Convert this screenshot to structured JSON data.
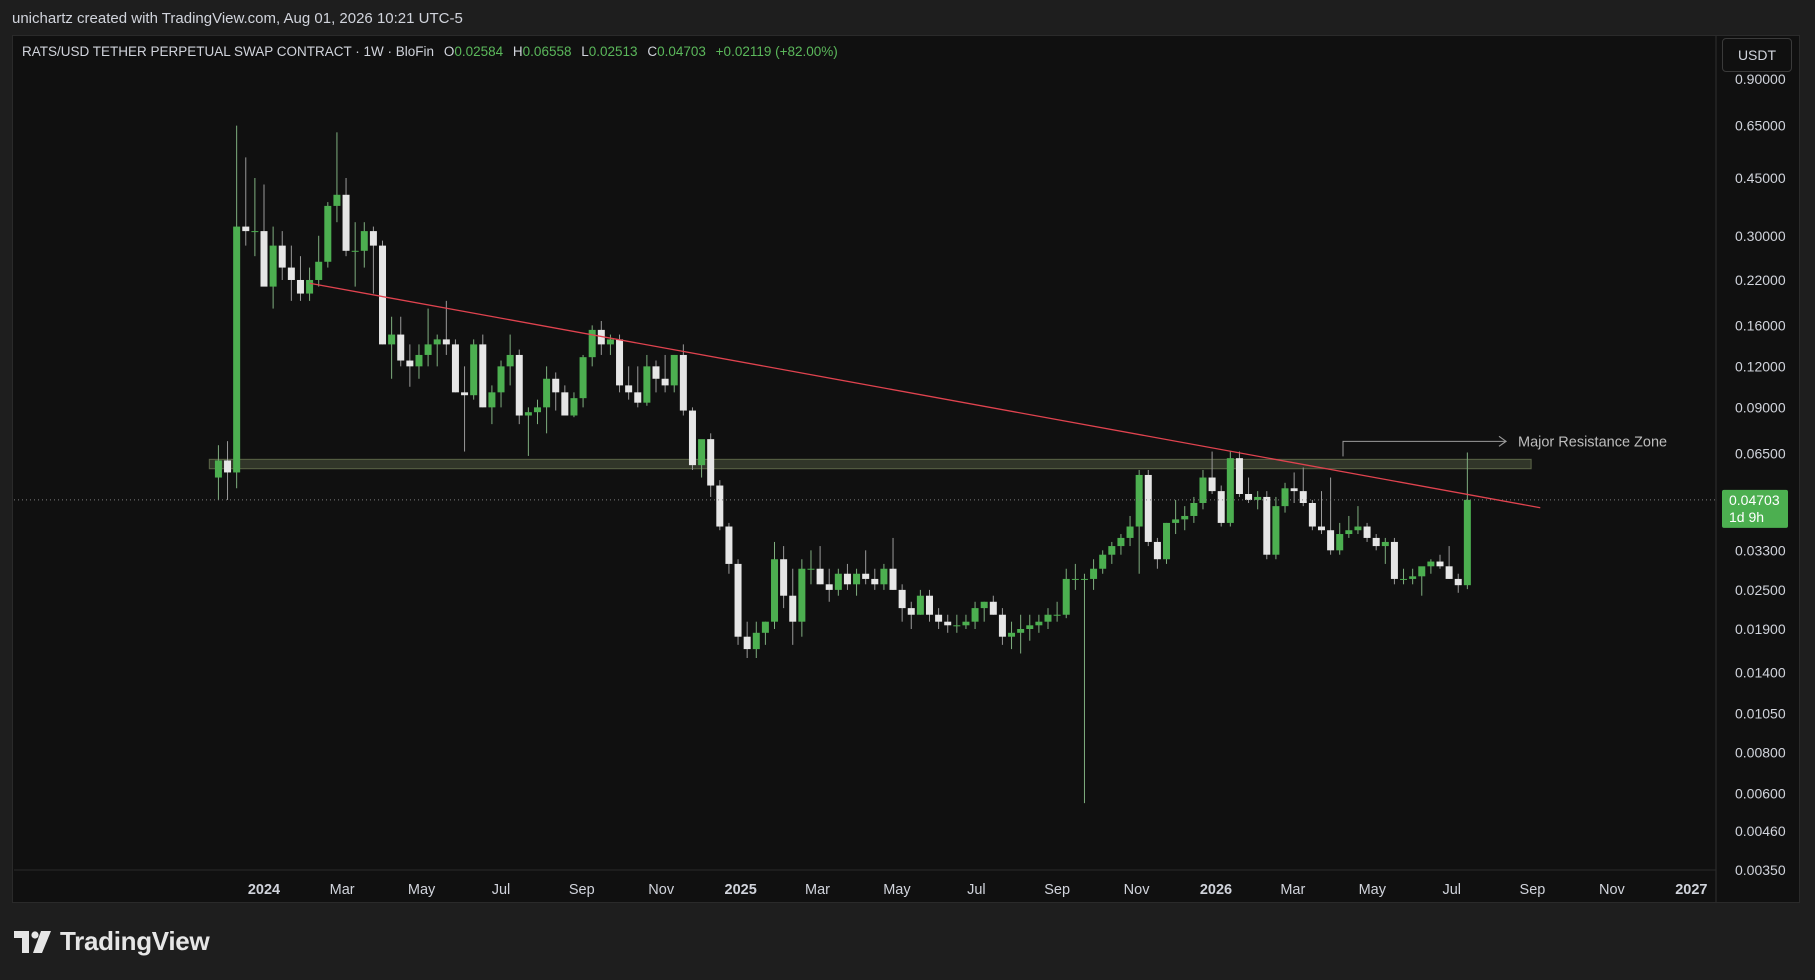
{
  "header": {
    "credit": "unichartz created with TradingView.com, Aug 01, 2026 10:21 UTC-5"
  },
  "legend": {
    "symbol": "RATS/USD TETHER PERPETUAL SWAP CONTRACT · 1W · BloFin",
    "o_label": "O",
    "o": "0.02584",
    "h_label": "H",
    "h": "0.06558",
    "l_label": "L",
    "l": "0.02513",
    "c_label": "C",
    "c": "0.04703",
    "change": "+0.02119 (+82.00%)"
  },
  "toolbar": {
    "currency_label": "USDT"
  },
  "price_label": {
    "price": "0.04703",
    "countdown": "1d 9h"
  },
  "annotation": {
    "resistance_label": "Major Resistance Zone"
  },
  "brand": {
    "name": "TradingView"
  },
  "colors": {
    "up": "#4caf50",
    "down": "#e6e6e6",
    "trendline": "#e0434f",
    "zone": "#8a9a6a",
    "price_tag": "#4caf50"
  },
  "chart_data": {
    "type": "candlestick",
    "timeframe": "1W",
    "y_scale": "log",
    "y_ticks": [
      "0.90000",
      "0.65000",
      "0.45000",
      "0.30000",
      "0.22000",
      "0.16000",
      "0.12000",
      "0.09000",
      "0.06500",
      "0.04703",
      "0.03300",
      "0.02500",
      "0.01900",
      "0.01400",
      "0.01050",
      "0.00800",
      "0.00600",
      "0.00460",
      "0.00350"
    ],
    "x_ticks": [
      {
        "label": "2024",
        "date": "2024-01-01",
        "bold": true
      },
      {
        "label": "Mar",
        "date": "2024-03-01"
      },
      {
        "label": "May",
        "date": "2024-05-01"
      },
      {
        "label": "Jul",
        "date": "2024-07-01"
      },
      {
        "label": "Sep",
        "date": "2024-09-01"
      },
      {
        "label": "Nov",
        "date": "2024-11-01"
      },
      {
        "label": "2025",
        "date": "2025-01-01",
        "bold": true
      },
      {
        "label": "Mar",
        "date": "2025-03-01"
      },
      {
        "label": "May",
        "date": "2025-05-01"
      },
      {
        "label": "Jul",
        "date": "2025-07-01"
      },
      {
        "label": "Sep",
        "date": "2025-09-01"
      },
      {
        "label": "Nov",
        "date": "2025-11-01"
      },
      {
        "label": "2026",
        "date": "2026-01-01",
        "bold": true
      },
      {
        "label": "Mar",
        "date": "2026-03-01"
      },
      {
        "label": "May",
        "date": "2026-05-01"
      },
      {
        "label": "Jul",
        "date": "2026-07-01"
      },
      {
        "label": "Sep",
        "date": "2026-09-01"
      },
      {
        "label": "Nov",
        "date": "2026-11-01"
      },
      {
        "label": "2027",
        "date": "2027-01-01",
        "bold": true
      }
    ],
    "candles": [
      {
        "d": "2023-11-27",
        "o": 0.055,
        "h": 0.069,
        "l": 0.047,
        "c": 0.062
      },
      {
        "d": "2023-12-04",
        "o": 0.062,
        "h": 0.071,
        "l": 0.047,
        "c": 0.057
      },
      {
        "d": "2023-12-11",
        "o": 0.057,
        "h": 0.65,
        "l": 0.051,
        "c": 0.32
      },
      {
        "d": "2023-12-18",
        "o": 0.32,
        "h": 0.52,
        "l": 0.28,
        "c": 0.31
      },
      {
        "d": "2023-12-25",
        "o": 0.31,
        "h": 0.45,
        "l": 0.26,
        "c": 0.31
      },
      {
        "d": "2024-01-01",
        "o": 0.31,
        "h": 0.43,
        "l": 0.24,
        "c": 0.21
      },
      {
        "d": "2024-01-08",
        "o": 0.21,
        "h": 0.32,
        "l": 0.18,
        "c": 0.28
      },
      {
        "d": "2024-01-15",
        "o": 0.28,
        "h": 0.31,
        "l": 0.22,
        "c": 0.24
      },
      {
        "d": "2024-01-22",
        "o": 0.24,
        "h": 0.28,
        "l": 0.19,
        "c": 0.22
      },
      {
        "d": "2024-01-29",
        "o": 0.22,
        "h": 0.26,
        "l": 0.19,
        "c": 0.2
      },
      {
        "d": "2024-02-05",
        "o": 0.2,
        "h": 0.24,
        "l": 0.19,
        "c": 0.22
      },
      {
        "d": "2024-02-12",
        "o": 0.22,
        "h": 0.3,
        "l": 0.21,
        "c": 0.25
      },
      {
        "d": "2024-02-19",
        "o": 0.25,
        "h": 0.38,
        "l": 0.24,
        "c": 0.37
      },
      {
        "d": "2024-02-26",
        "o": 0.37,
        "h": 0.62,
        "l": 0.33,
        "c": 0.4
      },
      {
        "d": "2024-03-04",
        "o": 0.4,
        "h": 0.45,
        "l": 0.26,
        "c": 0.27
      },
      {
        "d": "2024-03-11",
        "o": 0.27,
        "h": 0.33,
        "l": 0.21,
        "c": 0.27
      },
      {
        "d": "2024-03-18",
        "o": 0.27,
        "h": 0.33,
        "l": 0.24,
        "c": 0.31
      },
      {
        "d": "2024-03-25",
        "o": 0.31,
        "h": 0.32,
        "l": 0.2,
        "c": 0.28
      },
      {
        "d": "2024-04-01",
        "o": 0.28,
        "h": 0.29,
        "l": 0.14,
        "c": 0.14
      },
      {
        "d": "2024-04-08",
        "o": 0.14,
        "h": 0.17,
        "l": 0.11,
        "c": 0.15
      },
      {
        "d": "2024-04-15",
        "o": 0.15,
        "h": 0.17,
        "l": 0.12,
        "c": 0.125
      },
      {
        "d": "2024-04-22",
        "o": 0.125,
        "h": 0.14,
        "l": 0.104,
        "c": 0.12
      },
      {
        "d": "2024-04-29",
        "o": 0.12,
        "h": 0.14,
        "l": 0.11,
        "c": 0.13
      },
      {
        "d": "2024-05-06",
        "o": 0.13,
        "h": 0.18,
        "l": 0.12,
        "c": 0.14
      },
      {
        "d": "2024-05-13",
        "o": 0.14,
        "h": 0.15,
        "l": 0.12,
        "c": 0.145
      },
      {
        "d": "2024-05-20",
        "o": 0.145,
        "h": 0.19,
        "l": 0.13,
        "c": 0.14
      },
      {
        "d": "2024-05-27",
        "o": 0.14,
        "h": 0.145,
        "l": 0.1,
        "c": 0.1
      },
      {
        "d": "2024-06-03",
        "o": 0.1,
        "h": 0.12,
        "l": 0.066,
        "c": 0.098
      },
      {
        "d": "2024-06-10",
        "o": 0.098,
        "h": 0.145,
        "l": 0.095,
        "c": 0.14
      },
      {
        "d": "2024-06-17",
        "o": 0.14,
        "h": 0.15,
        "l": 0.09,
        "c": 0.09
      },
      {
        "d": "2024-06-24",
        "o": 0.09,
        "h": 0.105,
        "l": 0.08,
        "c": 0.1
      },
      {
        "d": "2024-07-01",
        "o": 0.1,
        "h": 0.125,
        "l": 0.09,
        "c": 0.12
      },
      {
        "d": "2024-07-08",
        "o": 0.12,
        "h": 0.15,
        "l": 0.105,
        "c": 0.13
      },
      {
        "d": "2024-07-15",
        "o": 0.13,
        "h": 0.135,
        "l": 0.08,
        "c": 0.085
      },
      {
        "d": "2024-07-22",
        "o": 0.085,
        "h": 0.09,
        "l": 0.064,
        "c": 0.087
      },
      {
        "d": "2024-07-29",
        "o": 0.087,
        "h": 0.095,
        "l": 0.08,
        "c": 0.09
      },
      {
        "d": "2024-08-05",
        "o": 0.09,
        "h": 0.12,
        "l": 0.075,
        "c": 0.11
      },
      {
        "d": "2024-08-12",
        "o": 0.11,
        "h": 0.115,
        "l": 0.088,
        "c": 0.1
      },
      {
        "d": "2024-08-19",
        "o": 0.1,
        "h": 0.105,
        "l": 0.085,
        "c": 0.085
      },
      {
        "d": "2024-08-26",
        "o": 0.085,
        "h": 0.1,
        "l": 0.084,
        "c": 0.096
      },
      {
        "d": "2024-09-02",
        "o": 0.096,
        "h": 0.13,
        "l": 0.09,
        "c": 0.128
      },
      {
        "d": "2024-09-09",
        "o": 0.128,
        "h": 0.16,
        "l": 0.12,
        "c": 0.155
      },
      {
        "d": "2024-09-16",
        "o": 0.155,
        "h": 0.165,
        "l": 0.13,
        "c": 0.14
      },
      {
        "d": "2024-09-23",
        "o": 0.14,
        "h": 0.15,
        "l": 0.13,
        "c": 0.145
      },
      {
        "d": "2024-09-30",
        "o": 0.145,
        "h": 0.15,
        "l": 0.1,
        "c": 0.105
      },
      {
        "d": "2024-10-07",
        "o": 0.105,
        "h": 0.12,
        "l": 0.095,
        "c": 0.1
      },
      {
        "d": "2024-10-14",
        "o": 0.1,
        "h": 0.12,
        "l": 0.09,
        "c": 0.093
      },
      {
        "d": "2024-10-21",
        "o": 0.093,
        "h": 0.13,
        "l": 0.091,
        "c": 0.12
      },
      {
        "d": "2024-10-28",
        "o": 0.12,
        "h": 0.125,
        "l": 0.1,
        "c": 0.11
      },
      {
        "d": "2024-11-04",
        "o": 0.11,
        "h": 0.13,
        "l": 0.1,
        "c": 0.105
      },
      {
        "d": "2024-11-11",
        "o": 0.105,
        "h": 0.13,
        "l": 0.1,
        "c": 0.13
      },
      {
        "d": "2024-11-18",
        "o": 0.13,
        "h": 0.14,
        "l": 0.085,
        "c": 0.088
      },
      {
        "d": "2024-11-25",
        "o": 0.088,
        "h": 0.09,
        "l": 0.058,
        "c": 0.06
      },
      {
        "d": "2024-12-02",
        "o": 0.06,
        "h": 0.07,
        "l": 0.055,
        "c": 0.072
      },
      {
        "d": "2024-12-09",
        "o": 0.072,
        "h": 0.075,
        "l": 0.048,
        "c": 0.052
      },
      {
        "d": "2024-12-16",
        "o": 0.052,
        "h": 0.054,
        "l": 0.038,
        "c": 0.039
      },
      {
        "d": "2024-12-23",
        "o": 0.039,
        "h": 0.04,
        "l": 0.028,
        "c": 0.03
      },
      {
        "d": "2024-12-30",
        "o": 0.03,
        "h": 0.031,
        "l": 0.017,
        "c": 0.018
      },
      {
        "d": "2025-01-06",
        "o": 0.018,
        "h": 0.02,
        "l": 0.0155,
        "c": 0.0165
      },
      {
        "d": "2025-01-13",
        "o": 0.0165,
        "h": 0.02,
        "l": 0.0155,
        "c": 0.0185
      },
      {
        "d": "2025-01-20",
        "o": 0.0185,
        "h": 0.02,
        "l": 0.017,
        "c": 0.02
      },
      {
        "d": "2025-01-27",
        "o": 0.02,
        "h": 0.035,
        "l": 0.019,
        "c": 0.031
      },
      {
        "d": "2025-02-03",
        "o": 0.031,
        "h": 0.034,
        "l": 0.022,
        "c": 0.024
      },
      {
        "d": "2025-02-10",
        "o": 0.024,
        "h": 0.029,
        "l": 0.017,
        "c": 0.02
      },
      {
        "d": "2025-02-17",
        "o": 0.02,
        "h": 0.031,
        "l": 0.018,
        "c": 0.029
      },
      {
        "d": "2025-02-24",
        "o": 0.029,
        "h": 0.033,
        "l": 0.026,
        "c": 0.029
      },
      {
        "d": "2025-03-03",
        "o": 0.029,
        "h": 0.034,
        "l": 0.026,
        "c": 0.026
      },
      {
        "d": "2025-03-10",
        "o": 0.026,
        "h": 0.029,
        "l": 0.023,
        "c": 0.025
      },
      {
        "d": "2025-03-17",
        "o": 0.025,
        "h": 0.029,
        "l": 0.024,
        "c": 0.028
      },
      {
        "d": "2025-03-24",
        "o": 0.028,
        "h": 0.03,
        "l": 0.025,
        "c": 0.026
      },
      {
        "d": "2025-03-31",
        "o": 0.026,
        "h": 0.029,
        "l": 0.024,
        "c": 0.028
      },
      {
        "d": "2025-04-07",
        "o": 0.028,
        "h": 0.033,
        "l": 0.026,
        "c": 0.027
      },
      {
        "d": "2025-04-14",
        "o": 0.027,
        "h": 0.029,
        "l": 0.025,
        "c": 0.026
      },
      {
        "d": "2025-04-21",
        "o": 0.026,
        "h": 0.03,
        "l": 0.025,
        "c": 0.029
      },
      {
        "d": "2025-04-28",
        "o": 0.029,
        "h": 0.036,
        "l": 0.025,
        "c": 0.025
      },
      {
        "d": "2025-05-05",
        "o": 0.025,
        "h": 0.026,
        "l": 0.02,
        "c": 0.022
      },
      {
        "d": "2025-05-12",
        "o": 0.022,
        "h": 0.023,
        "l": 0.019,
        "c": 0.021
      },
      {
        "d": "2025-05-19",
        "o": 0.021,
        "h": 0.025,
        "l": 0.021,
        "c": 0.024
      },
      {
        "d": "2025-05-26",
        "o": 0.024,
        "h": 0.025,
        "l": 0.02,
        "c": 0.021
      },
      {
        "d": "2025-06-02",
        "o": 0.021,
        "h": 0.022,
        "l": 0.019,
        "c": 0.02
      },
      {
        "d": "2025-06-09",
        "o": 0.02,
        "h": 0.021,
        "l": 0.0185,
        "c": 0.0195
      },
      {
        "d": "2025-06-16",
        "o": 0.0195,
        "h": 0.021,
        "l": 0.0185,
        "c": 0.0195
      },
      {
        "d": "2025-06-23",
        "o": 0.0195,
        "h": 0.021,
        "l": 0.019,
        "c": 0.02
      },
      {
        "d": "2025-06-30",
        "o": 0.02,
        "h": 0.023,
        "l": 0.019,
        "c": 0.022
      },
      {
        "d": "2025-07-07",
        "o": 0.022,
        "h": 0.023,
        "l": 0.02,
        "c": 0.023
      },
      {
        "d": "2025-07-14",
        "o": 0.023,
        "h": 0.024,
        "l": 0.021,
        "c": 0.021
      },
      {
        "d": "2025-07-21",
        "o": 0.021,
        "h": 0.022,
        "l": 0.017,
        "c": 0.018
      },
      {
        "d": "2025-07-28",
        "o": 0.018,
        "h": 0.02,
        "l": 0.0165,
        "c": 0.0185
      },
      {
        "d": "2025-08-04",
        "o": 0.0185,
        "h": 0.021,
        "l": 0.016,
        "c": 0.019
      },
      {
        "d": "2025-08-11",
        "o": 0.019,
        "h": 0.021,
        "l": 0.0175,
        "c": 0.0195
      },
      {
        "d": "2025-08-18",
        "o": 0.0195,
        "h": 0.021,
        "l": 0.0185,
        "c": 0.02
      },
      {
        "d": "2025-08-25",
        "o": 0.02,
        "h": 0.022,
        "l": 0.019,
        "c": 0.021
      },
      {
        "d": "2025-09-01",
        "o": 0.021,
        "h": 0.023,
        "l": 0.02,
        "c": 0.021
      },
      {
        "d": "2025-09-08",
        "o": 0.021,
        "h": 0.029,
        "l": 0.0205,
        "c": 0.027
      },
      {
        "d": "2025-09-15",
        "o": 0.027,
        "h": 0.03,
        "l": 0.025,
        "c": 0.027
      },
      {
        "d": "2025-09-22",
        "o": 0.027,
        "h": 0.028,
        "l": 0.0056,
        "c": 0.027
      },
      {
        "d": "2025-09-29",
        "o": 0.027,
        "h": 0.031,
        "l": 0.025,
        "c": 0.029
      },
      {
        "d": "2025-10-06",
        "o": 0.029,
        "h": 0.033,
        "l": 0.028,
        "c": 0.032
      },
      {
        "d": "2025-10-13",
        "o": 0.032,
        "h": 0.035,
        "l": 0.03,
        "c": 0.034
      },
      {
        "d": "2025-10-20",
        "o": 0.034,
        "h": 0.037,
        "l": 0.032,
        "c": 0.036
      },
      {
        "d": "2025-10-27",
        "o": 0.036,
        "h": 0.042,
        "l": 0.034,
        "c": 0.039
      },
      {
        "d": "2025-11-03",
        "o": 0.039,
        "h": 0.058,
        "l": 0.028,
        "c": 0.056
      },
      {
        "d": "2025-11-10",
        "o": 0.056,
        "h": 0.058,
        "l": 0.034,
        "c": 0.035
      },
      {
        "d": "2025-11-17",
        "o": 0.035,
        "h": 0.036,
        "l": 0.029,
        "c": 0.031
      },
      {
        "d": "2025-11-24",
        "o": 0.031,
        "h": 0.04,
        "l": 0.03,
        "c": 0.04
      },
      {
        "d": "2025-12-01",
        "o": 0.04,
        "h": 0.047,
        "l": 0.037,
        "c": 0.041
      },
      {
        "d": "2025-12-08",
        "o": 0.041,
        "h": 0.045,
        "l": 0.038,
        "c": 0.042
      },
      {
        "d": "2025-12-15",
        "o": 0.042,
        "h": 0.048,
        "l": 0.04,
        "c": 0.046
      },
      {
        "d": "2025-12-22",
        "o": 0.046,
        "h": 0.058,
        "l": 0.044,
        "c": 0.055
      },
      {
        "d": "2025-12-29",
        "o": 0.055,
        "h": 0.066,
        "l": 0.049,
        "c": 0.05
      },
      {
        "d": "2026-01-05",
        "o": 0.05,
        "h": 0.052,
        "l": 0.039,
        "c": 0.04
      },
      {
        "d": "2026-01-12",
        "o": 0.04,
        "h": 0.066,
        "l": 0.039,
        "c": 0.063
      },
      {
        "d": "2026-01-19",
        "o": 0.063,
        "h": 0.066,
        "l": 0.048,
        "c": 0.049
      },
      {
        "d": "2026-01-26",
        "o": 0.049,
        "h": 0.055,
        "l": 0.046,
        "c": 0.047
      },
      {
        "d": "2026-02-02",
        "o": 0.047,
        "h": 0.05,
        "l": 0.044,
        "c": 0.048
      },
      {
        "d": "2026-02-09",
        "o": 0.048,
        "h": 0.05,
        "l": 0.031,
        "c": 0.032
      },
      {
        "d": "2026-02-16",
        "o": 0.032,
        "h": 0.048,
        "l": 0.031,
        "c": 0.045
      },
      {
        "d": "2026-02-23",
        "o": 0.045,
        "h": 0.053,
        "l": 0.043,
        "c": 0.051
      },
      {
        "d": "2026-03-02",
        "o": 0.051,
        "h": 0.057,
        "l": 0.046,
        "c": 0.05
      },
      {
        "d": "2026-03-09",
        "o": 0.05,
        "h": 0.059,
        "l": 0.045,
        "c": 0.046
      },
      {
        "d": "2026-03-16",
        "o": 0.046,
        "h": 0.047,
        "l": 0.038,
        "c": 0.039
      },
      {
        "d": "2026-03-23",
        "o": 0.039,
        "h": 0.05,
        "l": 0.037,
        "c": 0.038
      },
      {
        "d": "2026-03-30",
        "o": 0.038,
        "h": 0.055,
        "l": 0.032,
        "c": 0.033
      },
      {
        "d": "2026-04-06",
        "o": 0.033,
        "h": 0.04,
        "l": 0.032,
        "c": 0.037
      },
      {
        "d": "2026-04-13",
        "o": 0.037,
        "h": 0.042,
        "l": 0.036,
        "c": 0.038
      },
      {
        "d": "2026-04-20",
        "o": 0.038,
        "h": 0.045,
        "l": 0.037,
        "c": 0.039
      },
      {
        "d": "2026-04-27",
        "o": 0.039,
        "h": 0.04,
        "l": 0.035,
        "c": 0.036
      },
      {
        "d": "2026-05-04",
        "o": 0.036,
        "h": 0.037,
        "l": 0.033,
        "c": 0.034
      },
      {
        "d": "2026-05-11",
        "o": 0.034,
        "h": 0.036,
        "l": 0.03,
        "c": 0.035
      },
      {
        "d": "2026-05-18",
        "o": 0.035,
        "h": 0.036,
        "l": 0.026,
        "c": 0.027
      },
      {
        "d": "2026-05-25",
        "o": 0.027,
        "h": 0.029,
        "l": 0.026,
        "c": 0.027
      },
      {
        "d": "2026-06-01",
        "o": 0.027,
        "h": 0.029,
        "l": 0.026,
        "c": 0.0275
      },
      {
        "d": "2026-06-08",
        "o": 0.0275,
        "h": 0.029,
        "l": 0.024,
        "c": 0.0295
      },
      {
        "d": "2026-06-15",
        "o": 0.0295,
        "h": 0.031,
        "l": 0.028,
        "c": 0.0305
      },
      {
        "d": "2026-06-22",
        "o": 0.0305,
        "h": 0.032,
        "l": 0.029,
        "c": 0.0295
      },
      {
        "d": "2026-06-29",
        "o": 0.0295,
        "h": 0.034,
        "l": 0.027,
        "c": 0.027
      },
      {
        "d": "2026-07-06",
        "o": 0.027,
        "h": 0.028,
        "l": 0.0245,
        "c": 0.02584
      },
      {
        "d": "2026-07-13",
        "o": 0.02584,
        "h": 0.06558,
        "l": 0.02513,
        "c": 0.04703
      }
    ],
    "trendline": {
      "from": {
        "date": "2024-02-05",
        "price": 0.215
      },
      "to": {
        "date": "2026-09-07",
        "price": 0.0445
      }
    },
    "resistance_zone": {
      "from_date": "2023-11-20",
      "to_date": "2026-08-31",
      "low": 0.0585,
      "high": 0.0625
    },
    "last_price": 0.04703
  }
}
